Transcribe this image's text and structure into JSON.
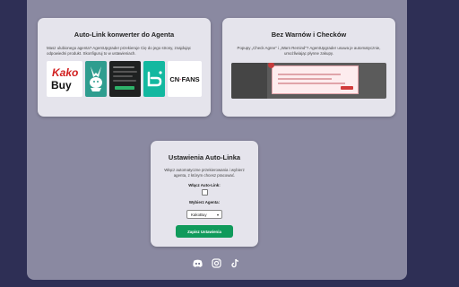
{
  "cards": {
    "autolink": {
      "title": "Auto-Link konwerter do Agenta",
      "text": "Masz ulubionego agenta? AgentUpgrader przekieruje Cię do jego strony, znajdując odpowiedni produkt. Skonfiguruj to w ustawieniach.",
      "logos": {
        "kako_line1": "Kako",
        "kako_line2": "Buy",
        "cnfans_a": "CN",
        "cnfans_dot": "·",
        "cnfans_b": "FANS"
      }
    },
    "nowarn": {
      "title": "Bez Warnów i Checków",
      "text": "Popupy „Check Agree\" i „Warn Remind\"? AgentUpgrader usuwa je automatycznie, umożliwiając płynne zakupy."
    },
    "settings": {
      "title": "Ustawienia Auto-Linka",
      "text": "Włącz automatyczne przekierowania i wybierz agenta, z którym chcesz pracować.",
      "enable_label": "Włącz Auto-Link:",
      "enable_checked": false,
      "agent_label": "Wybierz Agenta:",
      "agent_selected": "KakoBuy",
      "save_label": "Zapisz Ustawienia"
    }
  },
  "footer": {
    "icons": [
      "discord-icon",
      "instagram-icon",
      "tiktok-icon"
    ]
  },
  "colors": {
    "background": "#2e2f55",
    "panel": "#8a89a1",
    "card": "#e5e4ec",
    "save_button": "#109a5b"
  }
}
